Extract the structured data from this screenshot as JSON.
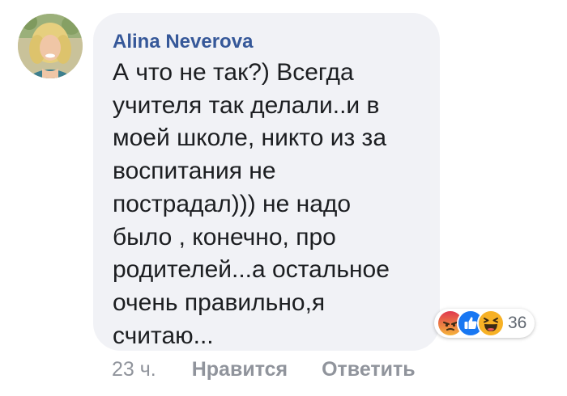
{
  "comment": {
    "author": "Alina Neverova",
    "lines": [
      "А что не так?) Всегда",
      "учителя так делали..и в",
      "моей школе, никто из за",
      "воспитания не",
      "пострадал))) не надо",
      "было , конечно, про",
      "родителей...а остальное",
      "очень правильно,я",
      "считаю..."
    ],
    "time": "23 ч.",
    "like_label": "Нравится",
    "reply_label": "Ответить"
  },
  "reactions": {
    "icons": [
      "angry-icon",
      "like-icon",
      "haha-icon"
    ],
    "count": "36"
  },
  "colors": {
    "author": "#365899",
    "bubble": "#f1f2f6",
    "text": "#1c1e21",
    "meta": "#90949c",
    "like_blue": "#1877f2",
    "angry_red": "#e9710f",
    "haha_yellow": "#f7b125"
  }
}
